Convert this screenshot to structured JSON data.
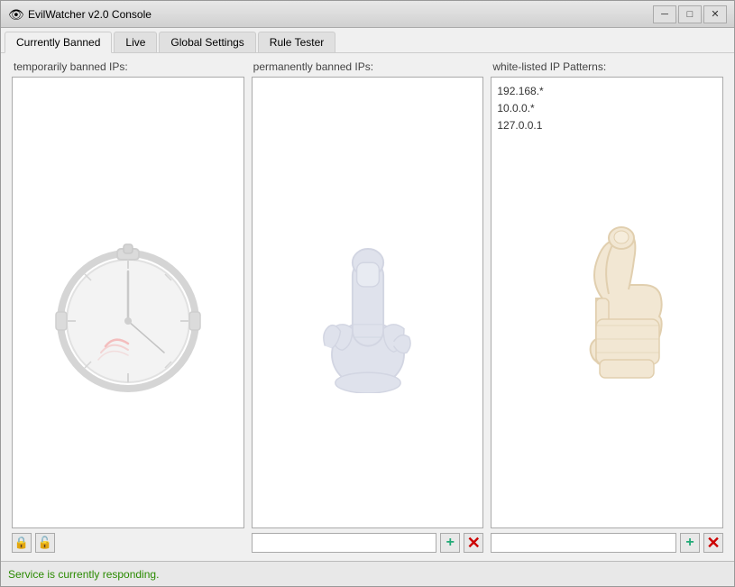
{
  "window": {
    "title": "EvilWatcher v2.0 Console",
    "icon": "👁"
  },
  "title_buttons": {
    "minimize": "─",
    "maximize": "□",
    "close": "✕"
  },
  "tabs": [
    {
      "label": "Currently Banned",
      "active": true
    },
    {
      "label": "Live",
      "active": false
    },
    {
      "label": "Global Settings",
      "active": false
    },
    {
      "label": "Rule Tester",
      "active": false
    }
  ],
  "panels": {
    "temp_banned": {
      "label": "temporarily banned IPs:",
      "input_placeholder": ""
    },
    "perm_banned": {
      "label": "permanently banned IPs:",
      "input_placeholder": ""
    },
    "whitelist": {
      "label": "white-listed IP Patterns:",
      "items": [
        "192.168.*",
        "10.0.0.*",
        "127.0.0.1"
      ],
      "input_placeholder": ""
    }
  },
  "status": {
    "text": "Service is currently responding."
  },
  "icons": {
    "lock_closed": "🔒",
    "lock_open": "🔓",
    "plus": "+",
    "cross": "✕"
  }
}
